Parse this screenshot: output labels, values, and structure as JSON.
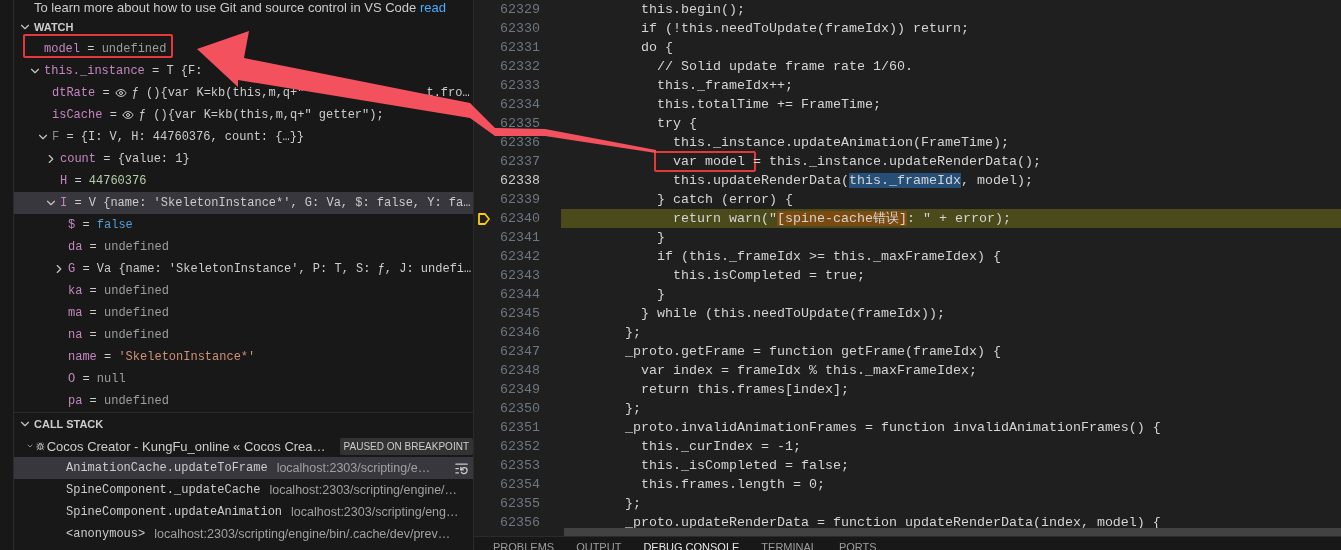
{
  "source_control_note": {
    "text": "To learn more about how to use Git and source control in VS Code",
    "link": "read"
  },
  "watch": {
    "title": "WATCH",
    "expanded": true,
    "items": [
      {
        "name": "model",
        "sign": "=",
        "value": "undefined",
        "kind": "undefined",
        "selected": false
      },
      {
        "name": "this._instance",
        "sign": "=",
        "value": "T {F:",
        "kind": "object",
        "expanded": true,
        "selected": false,
        "children": [
          {
            "name": "dtRate",
            "sign": "=",
            "value": "ƒ (){var K=kb(this,m,q+\"",
            "value_tail": "t.fro…",
            "kind": "getter",
            "selected": false
          },
          {
            "name": "isCache",
            "sign": "=",
            "value": "ƒ (){var K=kb(this,m,q+\" getter\");",
            "kind": "getter",
            "selected": false
          },
          {
            "name": "F",
            "sign": "=",
            "value": "{I: V, H: 44760376, count: {…}}",
            "kind": "object",
            "dimmed": true,
            "expanded": true,
            "selected": false,
            "children": [
              {
                "name": "count",
                "sign": "=",
                "value": "{value: 1}",
                "kind": "object",
                "expanded": false,
                "selected": false
              },
              {
                "name": "H",
                "sign": "=",
                "value": "44760376",
                "kind": "number",
                "selected": false
              },
              {
                "name": "I",
                "sign": "=",
                "value": "V {name: 'SkeletonInstance*', G: Va, $: false, Y: fa…",
                "kind": "object",
                "expanded": true,
                "selected": true,
                "children": [
                  {
                    "name": "$",
                    "sign": "=",
                    "value": "false",
                    "kind": "boolean",
                    "selected": false
                  },
                  {
                    "name": "da",
                    "sign": "=",
                    "value": "undefined",
                    "kind": "undefined",
                    "selected": false
                  },
                  {
                    "name": "G",
                    "sign": "=",
                    "value": "Va {name: 'SkeletonInstance', P: T, S: ƒ, J: undefi…",
                    "kind": "object",
                    "expanded": false,
                    "selected": false
                  },
                  {
                    "name": "ka",
                    "sign": "=",
                    "value": "undefined",
                    "kind": "undefined",
                    "selected": false
                  },
                  {
                    "name": "ma",
                    "sign": "=",
                    "value": "undefined",
                    "kind": "undefined",
                    "selected": false
                  },
                  {
                    "name": "na",
                    "sign": "=",
                    "value": "undefined",
                    "kind": "undefined",
                    "selected": false
                  },
                  {
                    "name": "name",
                    "sign": "=",
                    "value": "'SkeletonInstance*'",
                    "kind": "string",
                    "selected": false
                  },
                  {
                    "name": "O",
                    "sign": "=",
                    "value": "null",
                    "kind": "null",
                    "selected": false
                  },
                  {
                    "name": "pa",
                    "sign": "=",
                    "value": "undefined",
                    "kind": "undefined",
                    "selected": false
                  }
                ]
              }
            ]
          }
        ]
      }
    ]
  },
  "call_stack": {
    "title": "CALL STACK",
    "expanded": true,
    "session": {
      "name": "Cocos Creator - KungFu_online « Cocos Crea…",
      "status": "PAUSED ON BREAKPOINT",
      "expanded": true
    },
    "frames": [
      {
        "name": "AnimationCache.updateToFrame",
        "location": "localhost:2303/scripting/e…",
        "selected": true
      },
      {
        "name": "SpineComponent._updateCache",
        "location": "localhost:2303/scripting/engine/…",
        "selected": false
      },
      {
        "name": "SpineComponent.updateAnimation",
        "location": "localhost:2303/scripting/eng…",
        "selected": false
      },
      {
        "name": "<anonymous>",
        "location": "localhost:2303/scripting/engine/bin/.cache/dev/prev…",
        "selected": false
      }
    ]
  },
  "editor": {
    "lines": [
      {
        "number": "62329",
        "text": "          this.begin();",
        "cursor": false,
        "paused": false
      },
      {
        "number": "62330",
        "text": "          if (!this.needToUpdate(frameIdx)) return;",
        "cursor": false,
        "paused": false
      },
      {
        "number": "62331",
        "text": "          do {",
        "cursor": false,
        "paused": false
      },
      {
        "number": "62332",
        "text": "            // Solid update frame rate 1/60.",
        "cursor": false,
        "paused": false
      },
      {
        "number": "62333",
        "text": "            this._frameIdx++;",
        "cursor": false,
        "paused": false
      },
      {
        "number": "62334",
        "text": "            this.totalTime += FrameTime;",
        "cursor": false,
        "paused": false
      },
      {
        "number": "62335",
        "text": "            try {",
        "cursor": false,
        "paused": false
      },
      {
        "number": "62336",
        "text": "              this._instance.updateAnimation(FrameTime);",
        "cursor": false,
        "paused": false
      },
      {
        "number": "62337",
        "segments": [
          {
            "text": "              var model ",
            "kind": "annotated"
          },
          {
            "text": "= this._instance.updateRenderData();",
            "kind": "plain"
          }
        ],
        "cursor": false,
        "paused": false
      },
      {
        "number": "62338",
        "segments": [
          {
            "text": "              this.updateRenderData(",
            "kind": "plain"
          },
          {
            "text": "this._frameIdx",
            "kind": "selection"
          },
          {
            "text": ", model);",
            "kind": "plain"
          }
        ],
        "cursor": true,
        "paused": false
      },
      {
        "number": "62339",
        "text": "            } catch (error) {",
        "cursor": false,
        "paused": false
      },
      {
        "number": "62340",
        "segments": [
          {
            "text": "              return warn(\"",
            "kind": "plain"
          },
          {
            "text": "[spine-cache错误]",
            "kind": "match"
          },
          {
            "text": ": \" + error);",
            "kind": "plain"
          }
        ],
        "cursor": false,
        "paused": true
      },
      {
        "number": "62341",
        "text": "            }",
        "cursor": false,
        "paused": false
      },
      {
        "number": "62342",
        "text": "            if (this._frameIdx >= this._maxFrameIdex) {",
        "cursor": false,
        "paused": false
      },
      {
        "number": "62343",
        "text": "              this.isCompleted = true;",
        "cursor": false,
        "paused": false
      },
      {
        "number": "62344",
        "text": "            }",
        "cursor": false,
        "paused": false
      },
      {
        "number": "62345",
        "text": "          } while (this.needToUpdate(frameIdx));",
        "cursor": false,
        "paused": false
      },
      {
        "number": "62346",
        "text": "        };",
        "cursor": false,
        "paused": false
      },
      {
        "number": "62347",
        "text": "        _proto.getFrame = function getFrame(frameIdx) {",
        "cursor": false,
        "paused": false
      },
      {
        "number": "62348",
        "text": "          var index = frameIdx % this._maxFrameIdex;",
        "cursor": false,
        "paused": false
      },
      {
        "number": "62349",
        "text": "          return this.frames[index];",
        "cursor": false,
        "paused": false
      },
      {
        "number": "62350",
        "text": "        };",
        "cursor": false,
        "paused": false
      },
      {
        "number": "62351",
        "text": "        _proto.invalidAnimationFrames = function invalidAnimationFrames() {",
        "cursor": false,
        "paused": false
      },
      {
        "number": "62352",
        "text": "          this._curIndex = -1;",
        "cursor": false,
        "paused": false
      },
      {
        "number": "62353",
        "text": "          this._isCompleted = false;",
        "cursor": false,
        "paused": false
      },
      {
        "number": "62354",
        "text": "          this.frames.length = 0;",
        "cursor": false,
        "paused": false
      },
      {
        "number": "62355",
        "text": "        };",
        "cursor": false,
        "paused": false
      },
      {
        "number": "62356",
        "text": "        _proto.updateRenderData = function updateRenderData(index, model) {",
        "cursor": false,
        "paused": false
      }
    ]
  },
  "panel": {
    "tabs": [
      {
        "label": "PROBLEMS",
        "selected": false
      },
      {
        "label": "OUTPUT",
        "selected": false
      },
      {
        "label": "DEBUG CONSOLE",
        "selected": true
      },
      {
        "label": "TERMINAL",
        "selected": false
      },
      {
        "label": "PORTS",
        "selected": false
      }
    ]
  }
}
